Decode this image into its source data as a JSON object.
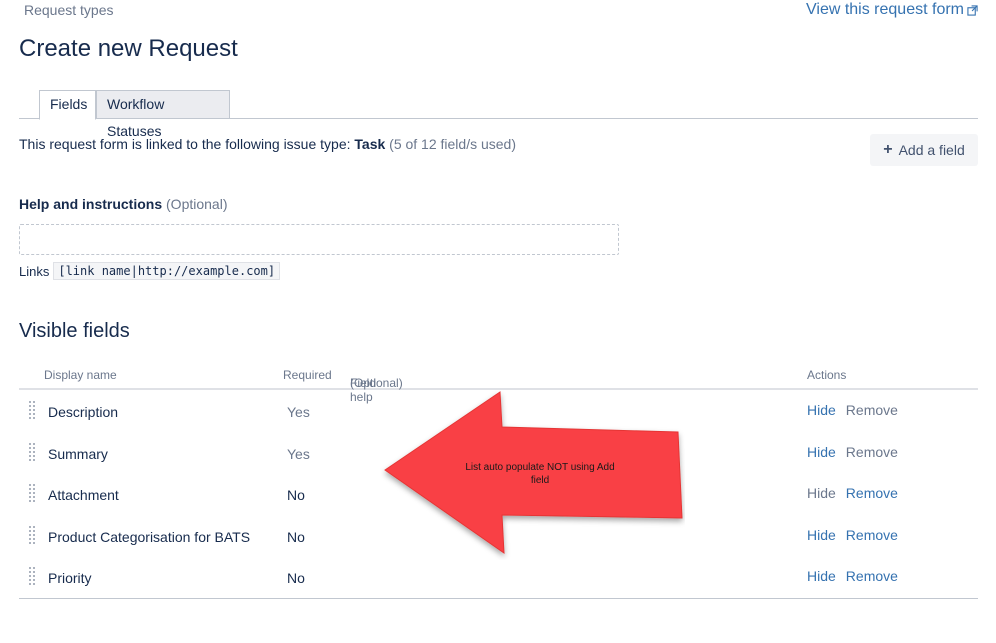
{
  "breadcrumb": "Request types",
  "view_link": "View this request form",
  "page_title": "Create new Request",
  "tabs": [
    {
      "label": "Fields",
      "active": true
    },
    {
      "label": "Workflow Statuses",
      "active": false
    }
  ],
  "linked": {
    "prefix": "This request form is linked to the following issue type: ",
    "issue_type": "Task",
    "usage": "(5 of 12 field/s used)"
  },
  "add_field_label": "Add a field",
  "help": {
    "label": "Help and instructions",
    "optional": "(Optional)",
    "value": ""
  },
  "links": {
    "label": "Links",
    "example": "[link name|http://example.com]"
  },
  "visible_fields_title": "Visible fields",
  "table": {
    "headers": {
      "display_name": "Display name",
      "required": "Required",
      "field_help": "Field help",
      "field_help_optional": "(Optional)",
      "actions": "Actions"
    },
    "rows": [
      {
        "name": "Description",
        "required": "Yes",
        "hide": "Hide",
        "remove": "Remove",
        "hide_active": true,
        "remove_active": false
      },
      {
        "name": "Summary",
        "required": "Yes",
        "hide": "Hide",
        "remove": "Remove",
        "hide_active": true,
        "remove_active": false
      },
      {
        "name": "Attachment",
        "required": "No",
        "hide": "Hide",
        "remove": "Remove",
        "hide_active": false,
        "remove_active": true
      },
      {
        "name": "Product Categorisation for BATS",
        "required": "No",
        "hide": "Hide",
        "remove": "Remove",
        "hide_active": true,
        "remove_active": true
      },
      {
        "name": "Priority",
        "required": "No",
        "hide": "Hide",
        "remove": "Remove",
        "hide_active": true,
        "remove_active": true
      }
    ]
  },
  "annotation": {
    "line1": "List auto populate NOT using Add",
    "line2": "field",
    "color": "#f94144"
  }
}
